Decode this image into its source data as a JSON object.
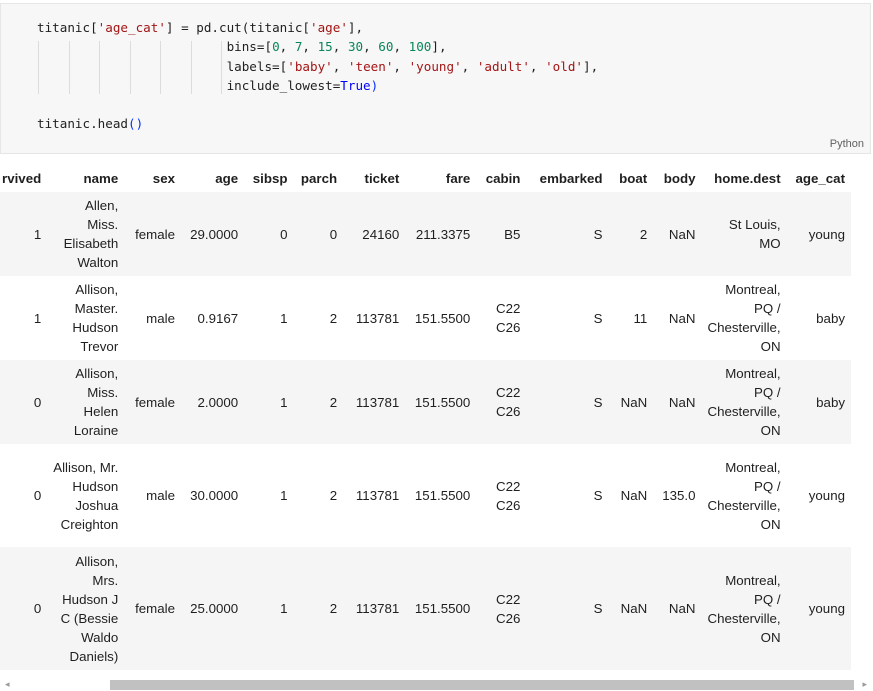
{
  "code_cell": {
    "language_label": "Python",
    "line1": {
      "a": "titanic[",
      "b": "'age_cat'",
      "c": "] = pd.cut(titanic[",
      "d": "'age'",
      "e": "],"
    },
    "line2": {
      "a": "bins=[",
      "n1": "0",
      "s1": ", ",
      "n2": "7",
      "s2": ", ",
      "n3": "15",
      "s3": ", ",
      "n4": "30",
      "s4": ", ",
      "n5": "60",
      "s5": ", ",
      "n6": "100",
      "e": "],"
    },
    "line3": {
      "a": "labels=[",
      "s1": "'baby'",
      "c1": ", ",
      "s2": "'teen'",
      "c2": ", ",
      "s3": "'young'",
      "c3": ", ",
      "s4": "'adult'",
      "c4": ", ",
      "s5": "'old'",
      "e": "],"
    },
    "line4": {
      "a": "include_lowest=",
      "kw": "True",
      "p": ")"
    },
    "line5": {
      "a": "titanic.head",
      "p": "()"
    }
  },
  "table": {
    "columns": [
      "rvived",
      "name",
      "sex",
      "age",
      "sibsp",
      "parch",
      "ticket",
      "fare",
      "cabin",
      "embarked",
      "boat",
      "body",
      "home.dest",
      "age_cat"
    ],
    "rows": [
      [
        "1",
        "Allen, Miss. Elisabeth Walton",
        "female",
        "29.0000",
        "0",
        "0",
        "24160",
        "211.3375",
        "B5",
        "S",
        "2",
        "NaN",
        "St Louis, MO",
        "young"
      ],
      [
        "1",
        "Allison, Master. Hudson Trevor",
        "male",
        "0.9167",
        "1",
        "2",
        "113781",
        "151.5500",
        "C22 C26",
        "S",
        "11",
        "NaN",
        "Montreal, PQ / Chesterville, ON",
        "baby"
      ],
      [
        "0",
        "Allison, Miss. Helen Loraine",
        "female",
        "2.0000",
        "1",
        "2",
        "113781",
        "151.5500",
        "C22 C26",
        "S",
        "NaN",
        "NaN",
        "Montreal, PQ / Chesterville, ON",
        "baby"
      ],
      [
        "0",
        "Allison, Mr. Hudson Joshua Creighton",
        "male",
        "30.0000",
        "1",
        "2",
        "113781",
        "151.5500",
        "C22 C26",
        "S",
        "NaN",
        "135.0",
        "Montreal, PQ / Chesterville, ON",
        "young"
      ],
      [
        "0",
        "Allison, Mrs. Hudson J C (Bessie Waldo Daniels)",
        "female",
        "25.0000",
        "1",
        "2",
        "113781",
        "151.5500",
        "C22 C26",
        "S",
        "NaN",
        "NaN",
        "Montreal, PQ / Chesterville, ON",
        "young"
      ]
    ]
  },
  "scrollbar": {
    "left_icon": "scroll-left-arrow",
    "right_icon": "scroll-right-arrow",
    "left_glyph": "◂",
    "right_glyph": "▸"
  }
}
